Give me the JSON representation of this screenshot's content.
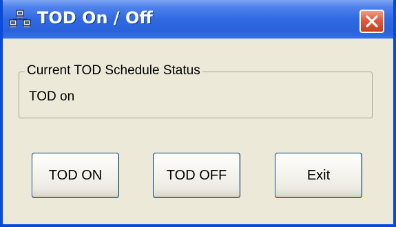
{
  "window": {
    "title": "TOD On / Off",
    "icon": "network-computers-icon",
    "close_label": "Close"
  },
  "status_group": {
    "legend": "Current TOD Schedule Status",
    "status_text": "TOD on"
  },
  "buttons": {
    "tod_on": "TOD ON",
    "tod_off": "TOD OFF",
    "exit": "Exit"
  },
  "colors": {
    "titlebar": "#2f6ae2",
    "window_bg": "#ece9d8",
    "close_button": "#df5a3c"
  }
}
